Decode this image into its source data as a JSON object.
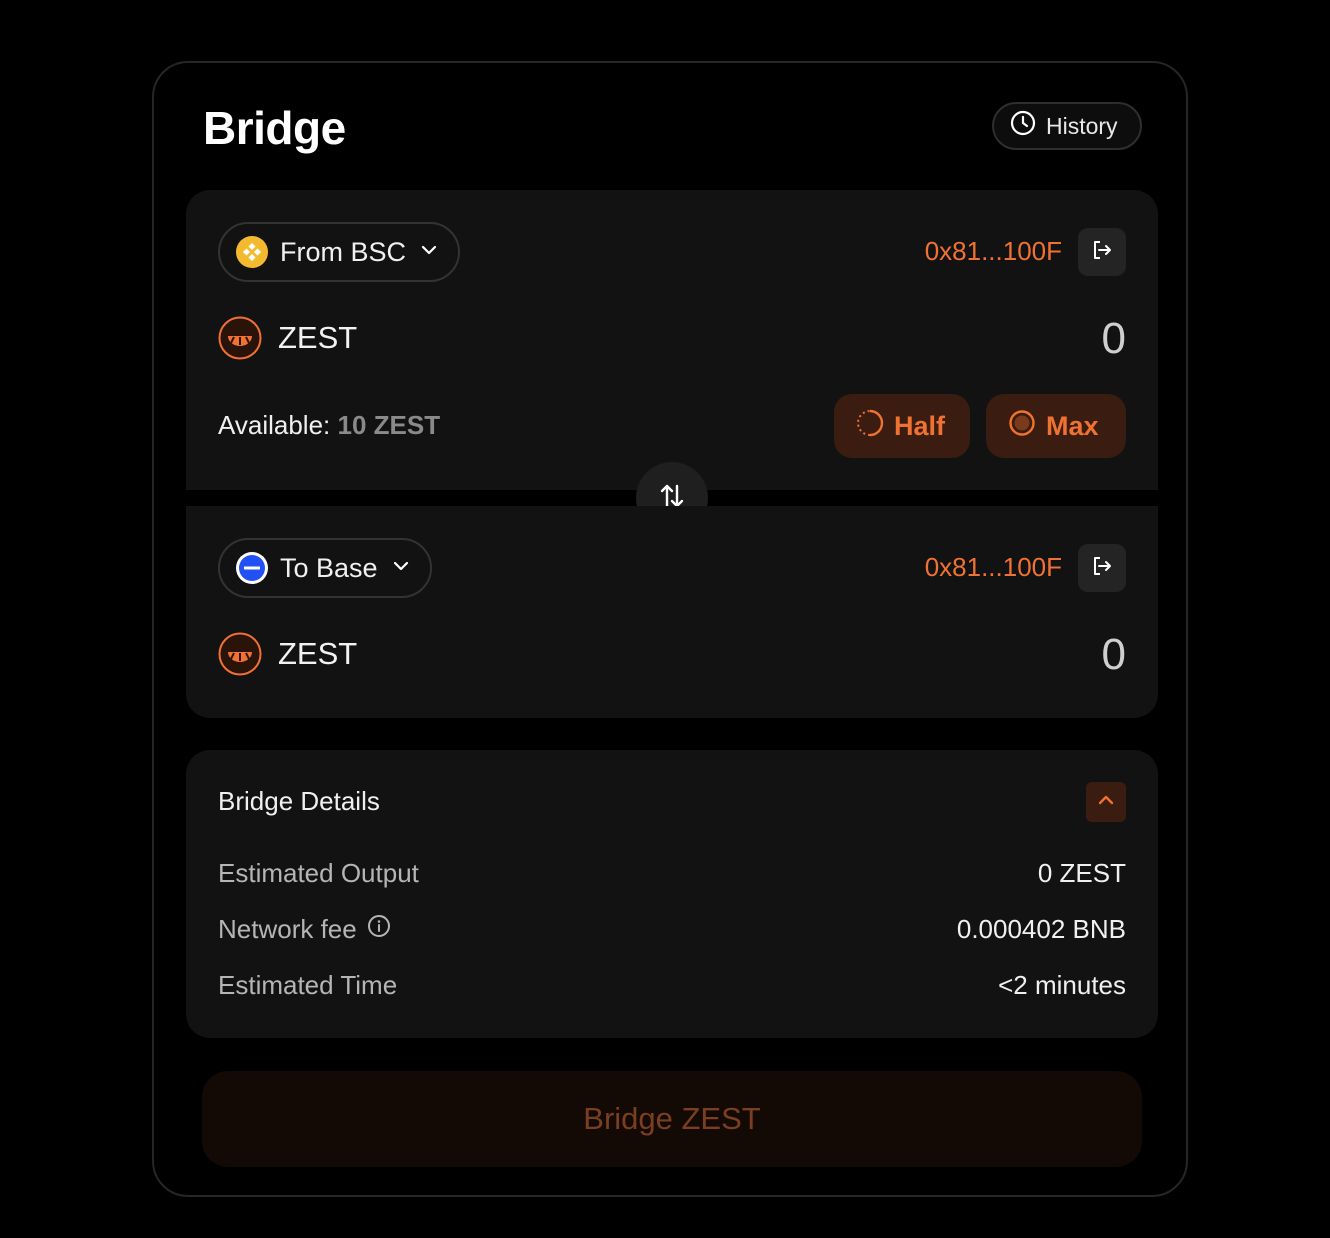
{
  "header": {
    "title": "Bridge",
    "history_label": "History"
  },
  "from": {
    "chain_label": "From BSC",
    "address": "0x81...100F",
    "token": "ZEST",
    "amount": "0",
    "available_label": "Available:",
    "available_value": "10 ZEST",
    "half_label": "Half",
    "max_label": "Max"
  },
  "to": {
    "chain_label": "To Base",
    "address": "0x81...100F",
    "token": "ZEST",
    "amount": "0"
  },
  "details": {
    "title": "Bridge Details",
    "rows": [
      {
        "label": "Estimated Output",
        "value": "0 ZEST"
      },
      {
        "label": "Network fee",
        "value": "0.000402 BNB"
      },
      {
        "label": "Estimated Time",
        "value": "<2 minutes"
      }
    ]
  },
  "action": {
    "bridge_label": "Bridge ZEST"
  },
  "colors": {
    "accent": "#f07232",
    "bsc": "#f3ba2f",
    "base": "#2151f5"
  },
  "icons": [
    "clock-icon",
    "bsc-chain-icon",
    "chevron-down-icon",
    "exit-icon",
    "zest-token-icon",
    "half-circle-icon",
    "max-circle-icon",
    "swap-arrows-icon",
    "base-chain-icon",
    "chevron-up-icon",
    "info-icon"
  ]
}
